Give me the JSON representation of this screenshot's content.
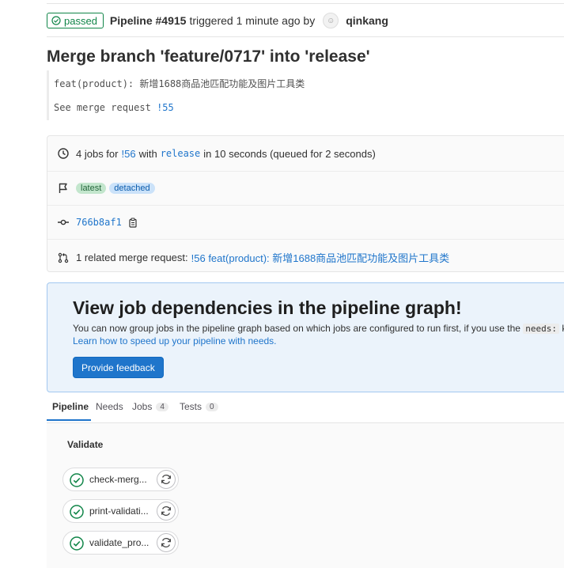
{
  "header": {
    "status": "passed",
    "pipeline": "Pipeline #4915",
    "triggered_text": "triggered 1 minute ago by",
    "author": "qinkang"
  },
  "commit": {
    "title": "Merge branch 'feature/0717' into 'release'",
    "description_line1": "feat(product): 新增1688商品池匹配功能及图片工具类",
    "description_line2_prefix": "See merge request",
    "merge_request_ref": "!55"
  },
  "info": {
    "jobs_count_text": "4 jobs for",
    "mr_ref": "!56",
    "with_text": "with",
    "branch": "release",
    "duration_text": "in 10 seconds (queued for 2 seconds)",
    "badges": [
      "latest",
      "detached"
    ],
    "commit_sha": "766b8af1",
    "related_mr_prefix": "1 related merge request:",
    "related_mr_link": "!56 feat(product): 新增1688商品池匹配功能及图片工具类"
  },
  "callout": {
    "title": "View job dependencies in the pipeline graph!",
    "body_prefix": "You can now group jobs in the pipeline graph based on which jobs are configured to run first, if you use the",
    "code": "needs:",
    "body_suffix": "keyw",
    "learn_link": "Learn how to speed up your pipeline with needs.",
    "button": "Provide feedback"
  },
  "tabs": [
    {
      "label": "Pipeline"
    },
    {
      "label": "Needs"
    },
    {
      "label": "Jobs",
      "count": "4"
    },
    {
      "label": "Tests",
      "count": "0"
    }
  ],
  "stage": {
    "name": "Validate",
    "jobs": [
      "check-merg...",
      "print-validati...",
      "validate_pro..."
    ]
  },
  "colors": {
    "success": "#108548",
    "link": "#1f75cb",
    "callout_bg": "#ebf3fb"
  }
}
